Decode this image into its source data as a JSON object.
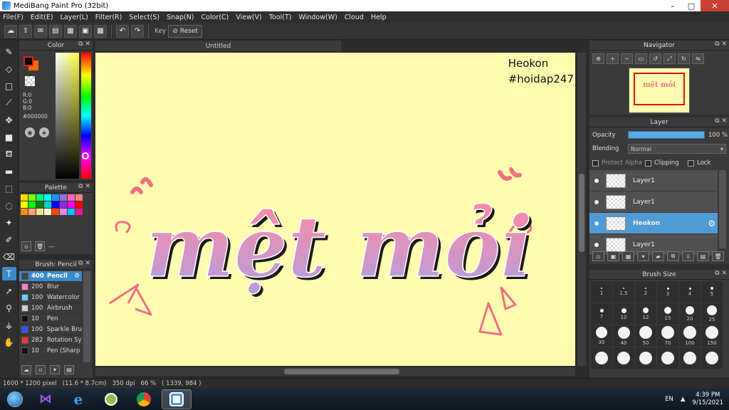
{
  "window": {
    "title": "MediBang Paint Pro (32bit)",
    "minimize": "–",
    "maximize": "□",
    "close": "✕"
  },
  "menu": [
    "File(F)",
    "Edit(E)",
    "Layer(L)",
    "Filter(R)",
    "Select(S)",
    "Snap(N)",
    "Color(C)",
    "View(V)",
    "Tool(T)",
    "Window(W)",
    "Cloud",
    "Help"
  ],
  "toolbar": {
    "key_label": "Key",
    "reset_label": "Reset"
  },
  "color_panel": {
    "title": "Color",
    "r": "R:0",
    "g": "G:0",
    "b": "B:0",
    "hex": "#000000",
    "fg": "#000000",
    "bg": "#ff6a00"
  },
  "palette_panel": {
    "title": "Palette",
    "colors": [
      "#ffd700",
      "#7fff00",
      "#00ff7f",
      "#00ffff",
      "#1e90ff",
      "#9370db",
      "#ff69b4",
      "#f08080",
      "#ffff00",
      "#00ff00",
      "#008000",
      "#00ced1",
      "#0000ff",
      "#8a2be2",
      "#ff00ff",
      "#ff0000",
      "#ff8c00",
      "#ffa07a",
      "#f0e68c",
      "#fffacd",
      "#ff4500",
      "#ee82ee",
      "#00bfff",
      "#ff1493"
    ],
    "ellipsis": "---"
  },
  "brush_panel": {
    "title": "Brush: Pencil",
    "items": [
      {
        "size": "400",
        "name": "Pencil",
        "color": "#444444",
        "selected": true
      },
      {
        "size": "200",
        "name": "Blur",
        "color": "#ff80c0",
        "selected": false
      },
      {
        "size": "100",
        "name": "Watercolor",
        "color": "#66ccff",
        "selected": false
      },
      {
        "size": "100",
        "name": "Airbrush",
        "color": "#cccccc",
        "selected": false
      },
      {
        "size": "10",
        "name": "Pen",
        "color": "#111111",
        "selected": false
      },
      {
        "size": "100",
        "name": "Sparkle Bru",
        "color": "#3355ff",
        "selected": false
      },
      {
        "size": "282",
        "name": "Rotation Sy",
        "color": "#ff3333",
        "selected": false
      },
      {
        "size": "10",
        "name": "Pen (Sharp",
        "color": "#111111",
        "selected": false
      }
    ]
  },
  "canvas": {
    "tab_title": "Untitled",
    "watermark_line1": "Heokon",
    "watermark_line2": "#hoidap247",
    "art_text": "mệt mỏi"
  },
  "navigator": {
    "title": "Navigator",
    "thumb_text": "mệt mỏi"
  },
  "layer_panel": {
    "title": "Layer",
    "opacity_label": "Opacity",
    "opacity_value": "100 %",
    "blending_label": "Blending",
    "blending_value": "Normal",
    "protect_alpha": "Protect Alpha",
    "clipping": "Clipping",
    "lock": "Lock",
    "layers": [
      {
        "name": "Layer1",
        "selected": false
      },
      {
        "name": "Layer1",
        "selected": false
      },
      {
        "name": "Heokon",
        "selected": true
      },
      {
        "name": "Layer1",
        "selected": false
      }
    ]
  },
  "brush_size": {
    "title": "Brush Size",
    "sizes": [
      "1",
      "1.5",
      "2",
      "3",
      "4",
      "5",
      "7",
      "10",
      "12",
      "15",
      "20",
      "25",
      "30",
      "40",
      "50",
      "70",
      "100",
      "150",
      "",
      "",
      "",
      "",
      "",
      ""
    ]
  },
  "status": {
    "dims": "1600 * 1200 pixel",
    "physical": "(11.6 * 8.7cm)",
    "dpi": "350 dpi",
    "zoom": "66 %",
    "coords": "( 1339, 984 )"
  },
  "taskbar": {
    "lang": "EN",
    "time": "4:39 PM",
    "date": "9/15/2021"
  }
}
